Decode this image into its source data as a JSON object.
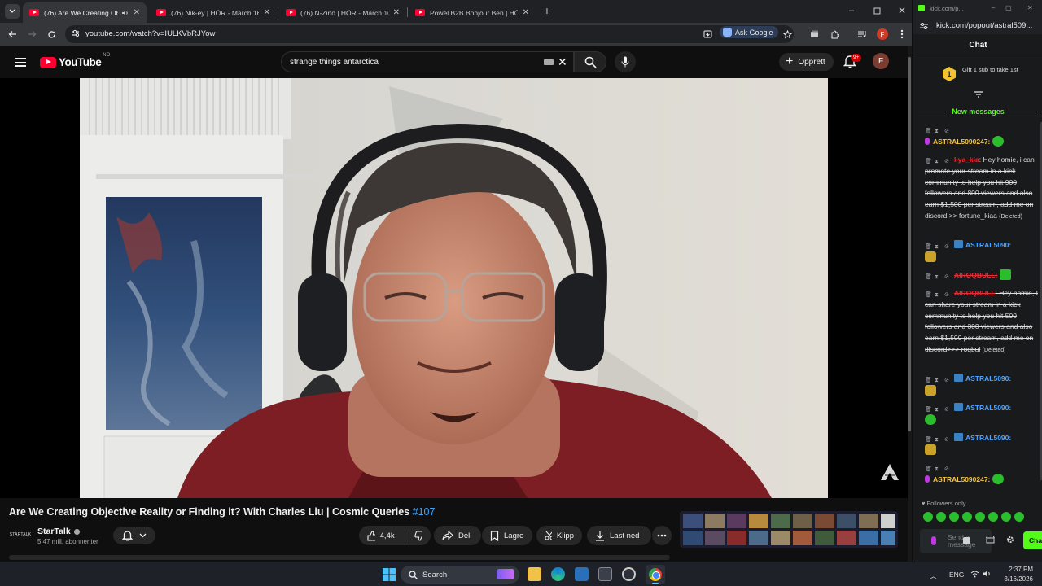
{
  "browser": {
    "tabs": [
      {
        "title": "(76) Are We Creating Objec",
        "active": true
      },
      {
        "title": "(76) Nik-ey | HÖR - March 16 /",
        "active": false
      },
      {
        "title": "(76) N-Zino | HÖR - March 16 /",
        "active": false
      },
      {
        "title": "Powel B2B Bonjour Ben | HÖR -",
        "active": false
      }
    ],
    "url": "youtube.com/watch?v=IULKVbRJYow",
    "ask_google": "Ask Google",
    "profile_initial": "F"
  },
  "youtube": {
    "logo": "YouTube",
    "country": "NO",
    "search_query": "strange things antarctica",
    "create_label": "Opprett",
    "notification_count": "9+",
    "avatar_initial": "F",
    "video": {
      "title": "Are We Creating Objective Reality or Finding it? With Charles Liu | Cosmic Queries",
      "title_tag": "#107",
      "channel": "StarTalk",
      "channel_avatar_text": "STARTALK",
      "subscribers": "5,47 mill. abonnenter",
      "likes": "4,4k",
      "share": "Del",
      "save": "Lagre",
      "clip": "Klipp",
      "download": "Last ned"
    }
  },
  "kick": {
    "window_title": "kick.com/p...",
    "url": "kick.com/popout/astral509...",
    "chat_title": "Chat",
    "gift_rank": "1",
    "gift_text": "Gift 1 sub to take 1st",
    "new_messages": "New messages",
    "messages": [
      {
        "user": "ASTRAL5090247:",
        "user_color": "#f5c542",
        "text": "",
        "emote": "green"
      },
      {
        "user": "liya_kia",
        "user_color": "#e0303a",
        "text": ": Hey homie, i can promote your stream in a kick community to help you hit 900 followers and 800 viewers and also earn $1,500 per stream, add me on discord >> fortune_kiaa",
        "deleted": "(Deleted)"
      },
      {
        "user": "ASTRAL5090:",
        "user_color": "#4fa3ff",
        "text": "",
        "emote": "gold"
      },
      {
        "user": "AIROQBULL:",
        "user_color": "#e0303a",
        "text": "",
        "emote": "green-sq"
      },
      {
        "user": "AIROQBULL",
        "user_color": "#e0303a",
        "text": ": Hey homie, I can share your stream in a kick community to help you hit 500 followers and 300 viewers and also earn $1,500 per stream, add me on discord>>> roqbul",
        "deleted": "(Deleted)"
      },
      {
        "user": "ASTRAL5090:",
        "user_color": "#4fa3ff",
        "text": "",
        "emote": "gold"
      },
      {
        "user": "ASTRAL5090:",
        "user_color": "#4fa3ff",
        "text": "",
        "emote": "green"
      },
      {
        "user": "ASTRAL5090:",
        "user_color": "#4fa3ff",
        "text": "",
        "emote": "gold"
      },
      {
        "user": "ASTRAL5090247:",
        "user_color": "#f5c542",
        "text": "",
        "emote": "green"
      }
    ],
    "followers_only": "Followers only",
    "input_placeholder": "Send a message",
    "chat_button": "Cha"
  },
  "taskbar": {
    "search_label": "Search",
    "language": "ENG",
    "time": "2:37 PM",
    "date": "3/16/2026"
  }
}
